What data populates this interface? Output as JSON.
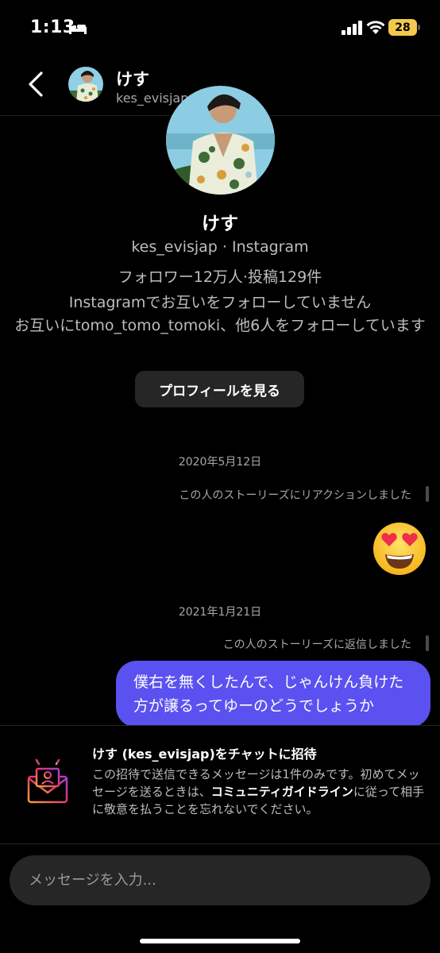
{
  "status_bar": {
    "time": "1:13",
    "battery": "28",
    "icons": [
      "bed-icon",
      "signal-icon",
      "wifi-icon"
    ]
  },
  "header": {
    "back_icon": "chevron-left-icon",
    "name": "けす",
    "username": "kes_evisjap"
  },
  "profile": {
    "name": "けす",
    "handle_line": "kes_evisjap · Instagram",
    "stats_line": "フォロワー12万人·投稿129件",
    "follow_status": "Instagramでお互いをフォローしていません",
    "mutual_line": "お互いにtomo_tomo_tomoki、他6人をフォローしています",
    "view_profile_label": "プロフィールを見る"
  },
  "messages": {
    "date_1": "2020年5月12日",
    "story_reaction_note": "この人のストーリーズにリアクションしました",
    "reaction_emoji": "heart-eyes-emoji",
    "date_2": "2021年1月21日",
    "story_reply_note": "この人のストーリーズに返信しました",
    "sent_message": "僕右を無くしたんで、じゃんけん負けた方が譲るってゆーのどうでしょうか"
  },
  "invite": {
    "icon": "envelope-invite-icon",
    "title": "けす (kes_evisjap)をチャットに招待",
    "body_prefix": "この招待で送信できるメッセージは1件のみです。初めてメッセージを送るときは、",
    "body_link": "コミュニティガイドライン",
    "body_suffix": "に従って相手に敬意を払うことを忘れないでください。"
  },
  "composer": {
    "placeholder": "メッセージを入力..."
  },
  "colors": {
    "background": "#000000",
    "bubble": "#5b51f0",
    "button": "#262626",
    "battery": "#f2c94c"
  }
}
